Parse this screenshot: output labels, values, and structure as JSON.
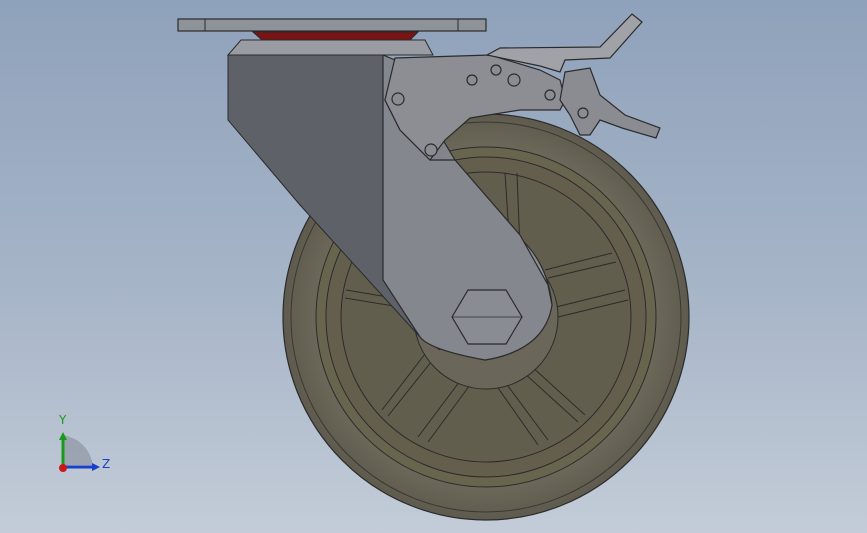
{
  "viewport": {
    "background_top": "#8fa2bb",
    "background_bottom": "#c3ccd8"
  },
  "model": {
    "name_icon": "swivel-caster-with-brake-model",
    "colors": {
      "wheel_tread": "#6c6a5a",
      "wheel_hub": "#645f50",
      "fork": "#767880",
      "top_plate": "#8a8e96",
      "bearing_ring": "#7a1414",
      "brake": "#8c8e94",
      "edge": "#2b2b2b"
    }
  },
  "triad": {
    "y_label": "Y",
    "z_label": "Z",
    "y_color": "#1a9a1a",
    "z_color": "#1a3fc8",
    "origin_color": "#c81818"
  }
}
